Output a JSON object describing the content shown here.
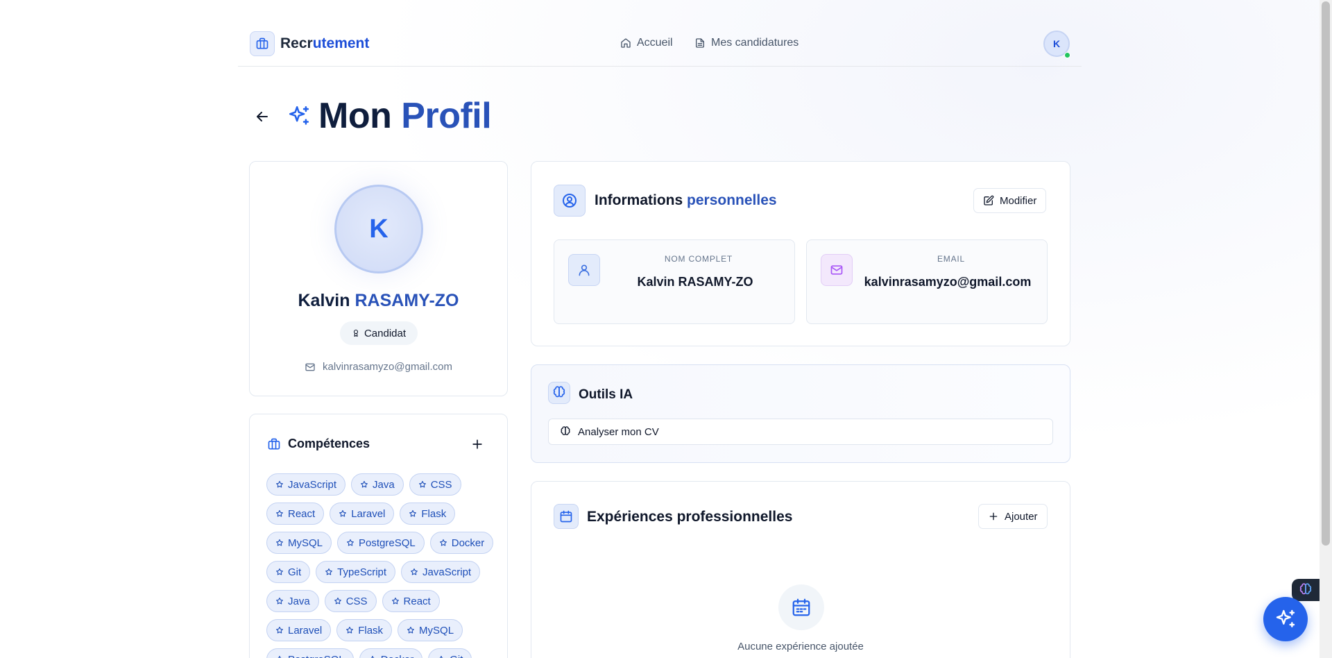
{
  "header": {
    "brand_prefix": "Recr",
    "brand_accent": "utement",
    "nav": [
      {
        "label": "Accueil",
        "icon": "home-icon"
      },
      {
        "label": "Mes candidatures",
        "icon": "document-icon"
      }
    ],
    "avatar_initial": "K"
  },
  "page": {
    "title_prefix": "Mon ",
    "title_accent": "Profil"
  },
  "profile": {
    "initial": "K",
    "first_name": "Kalvin ",
    "last_name": "RASAMY-ZO",
    "role": "Candidat",
    "email": "kalvinrasamyzo@gmail.com"
  },
  "skills": {
    "title": "Compétences",
    "items": [
      "JavaScript",
      "Java",
      "CSS",
      "React",
      "Laravel",
      "Flask",
      "MySQL",
      "PostgreSQL",
      "Docker",
      "Git",
      "TypeScript",
      "JavaScript",
      "Java",
      "CSS",
      "React",
      "Laravel",
      "Flask",
      "MySQL",
      "PostgreSQL",
      "Docker",
      "Git"
    ]
  },
  "info": {
    "title_prefix": "Informations ",
    "title_accent": "personnelles",
    "edit_label": "Modifier",
    "name_label": "NOM COMPLET",
    "name_value": "Kalvin RASAMY-ZO",
    "email_label": "EMAIL",
    "email_value": "kalvinrasamyzo@gmail.com"
  },
  "ia_tools": {
    "title": "Outils IA",
    "analyze_label": "Analyser mon CV"
  },
  "experience": {
    "title": "Expériences professionnelles",
    "add_label": "Ajouter",
    "empty_text": "Aucune expérience ajoutée"
  },
  "colors": {
    "accent": "#2563eb",
    "title_dark": "#0f1e3d",
    "chip_bg": "#e9effc",
    "online": "#22c55e"
  }
}
